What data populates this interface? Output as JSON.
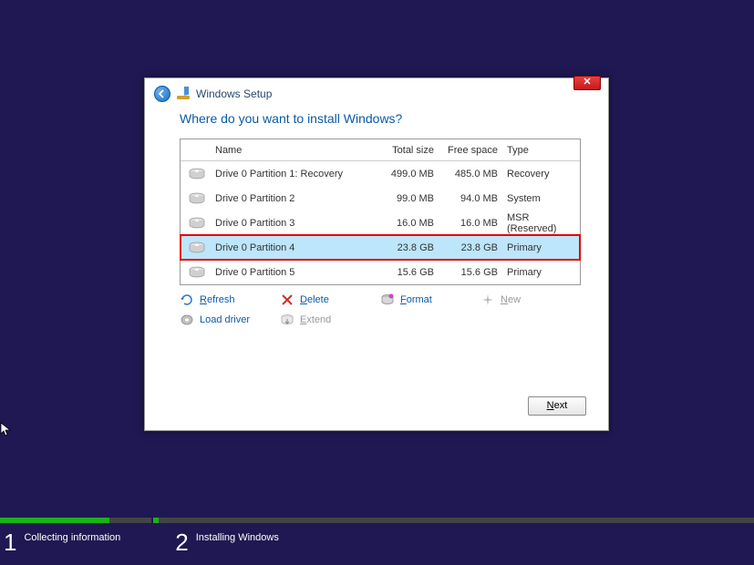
{
  "window": {
    "title": "Windows Setup"
  },
  "heading": "Where do you want to install Windows?",
  "columns": {
    "name": "Name",
    "total": "Total size",
    "free": "Free space",
    "type": "Type"
  },
  "partitions": [
    {
      "name": "Drive 0 Partition 1: Recovery",
      "total": "499.0 MB",
      "free": "485.0 MB",
      "type": "Recovery",
      "selected": false
    },
    {
      "name": "Drive 0 Partition 2",
      "total": "99.0 MB",
      "free": "94.0 MB",
      "type": "System",
      "selected": false
    },
    {
      "name": "Drive 0 Partition 3",
      "total": "16.0 MB",
      "free": "16.0 MB",
      "type": "MSR (Reserved)",
      "selected": false
    },
    {
      "name": "Drive 0 Partition 4",
      "total": "23.8 GB",
      "free": "23.8 GB",
      "type": "Primary",
      "selected": true
    },
    {
      "name": "Drive 0 Partition 5",
      "total": "15.6 GB",
      "free": "15.6 GB",
      "type": "Primary",
      "selected": false
    }
  ],
  "actions": {
    "refresh": "Refresh",
    "delete": "Delete",
    "format": "Format",
    "new": "New",
    "load_driver": "Load driver",
    "extend": "Extend"
  },
  "next_label": "Next",
  "steps": {
    "s1_num": "1",
    "s1_label": "Collecting information",
    "s2_num": "2",
    "s2_label": "Installing Windows"
  }
}
